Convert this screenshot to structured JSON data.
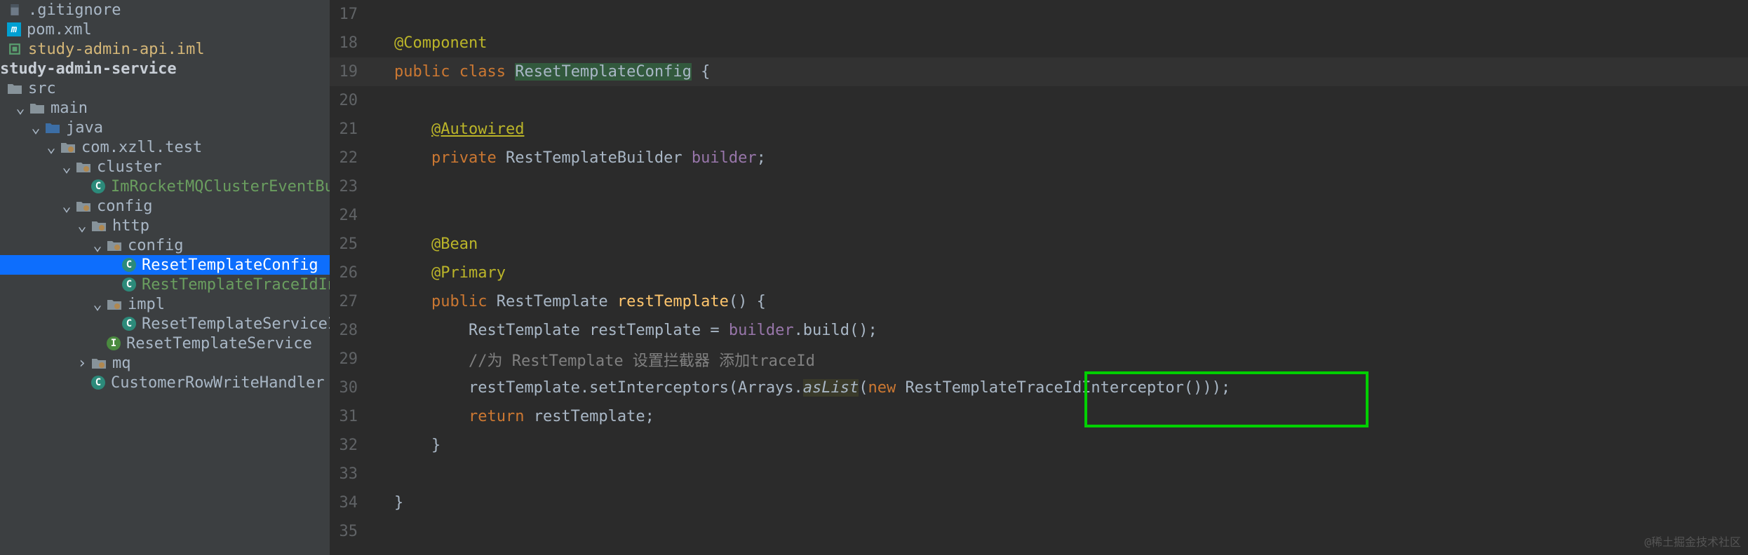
{
  "tree": {
    "gitignore": ".gitignore",
    "pom": "pom.xml",
    "iml": "study-admin-api.iml",
    "module": "study-admin-service",
    "src": "src",
    "main": "main",
    "java": "java",
    "pkg": "com.xzll.test",
    "cluster": "cluster",
    "consumer": "ImRocketMQClusterEventBusConsumer",
    "config": "config",
    "http": "http",
    "config2": "config",
    "resetCfg": "ResetTemplateConfig",
    "interceptor": "RestTemplateTraceIdInterceptor",
    "impl": "impl",
    "svcImpl": "ResetTemplateServiceImpl",
    "svc": "ResetTemplateService",
    "mq": "mq",
    "handler": "CustomerRowWriteHandler"
  },
  "lines": {
    "l17": "17",
    "l18": "18",
    "l19": "19",
    "l20": "20",
    "l21": "21",
    "l22": "22",
    "l23": "23",
    "l24": "24",
    "l25": "25",
    "l26": "26",
    "l27": "27",
    "l28": "28",
    "l29": "29",
    "l30": "30",
    "l31": "31",
    "l32": "32",
    "l33": "33",
    "l34": "34",
    "l35": "35"
  },
  "code": {
    "component": "@Component",
    "pub": "public",
    "cls": "class",
    "cfgName": "ResetTemplateConfig",
    "brace_o": "{",
    "brace_c": "}",
    "autowired": "@Autowired",
    "priv": "private",
    "builderType": "RestTemplateBuilder",
    "builder": "builder",
    "semi": ";",
    "bean": "@Bean",
    "primary": "@Primary",
    "rtType": "RestTemplate",
    "rtMethod": "restTemplate",
    "parens": "() {",
    "decl_a": "RestTemplate restTemplate = ",
    "decl_build": ".build();",
    "comment": "//为 RestTemplate 设置拦截器 添加traceId",
    "setInt_a": "restTemplate.setInterceptors(Arrays.",
    "asList": "asList",
    "setInt_b": "(",
    "new": "new",
    "intClass": " RestTemplateTraceIdInterceptor()));",
    "ret": "return",
    "retVar": " restTemplate;"
  },
  "watermark": "@稀土掘金技术社区"
}
